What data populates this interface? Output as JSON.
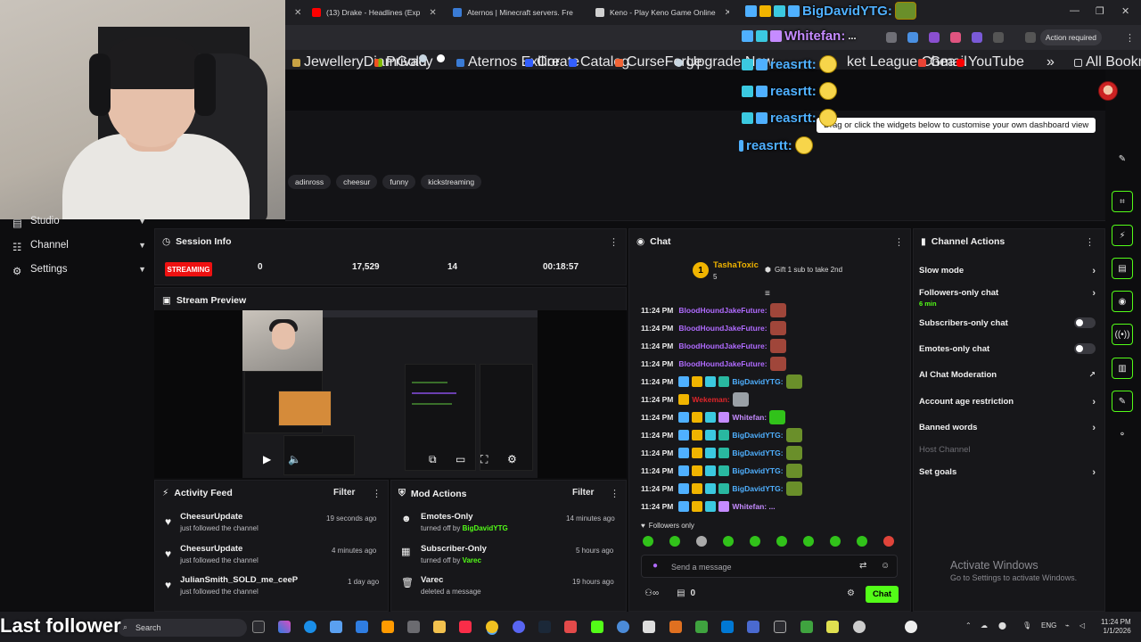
{
  "browser": {
    "tabs": [
      {
        "label": "(13) Drake - Headlines (Exp",
        "color": "#ff0000"
      },
      {
        "label": "Aternos | Minecraft servers. Fre",
        "color": "#3a7bd5"
      },
      {
        "label": "Keno - Play Keno Game Online",
        "color": "#d0d0d0"
      }
    ],
    "action_required": "Action required",
    "bookmarks": [
      "JewelleryDiamGold",
      "Privacy",
      "Aternos Exilior",
      "Create",
      "Catalog",
      "CurseForge",
      "Upgrade Now",
      "ket League Chea...",
      "Gmail",
      "YouTube",
      "All Bookmarks"
    ]
  },
  "overlay": {
    "chat": [
      {
        "name": "BigDavidYTG:",
        "color": "#4fb0ff"
      },
      {
        "name": "Whitefan:",
        "suffix": "...",
        "color": "#c58bff"
      },
      {
        "name": "reasrtt:",
        "color": "#4fb0ff"
      },
      {
        "name": "reasrtt:",
        "color": "#4fb0ff"
      },
      {
        "name": "reasrtt:",
        "color": "#4fb0ff"
      },
      {
        "name": "reasrtt:",
        "color": "#4fb0ff"
      }
    ],
    "last_follower": "Last follower"
  },
  "dashboard": {
    "tip": "Drag or click the widgets below to customise your own dashboard view",
    "tags": [
      "adinross",
      "cheesur",
      "funny",
      "kickstreaming"
    ]
  },
  "sidebar": {
    "items": [
      {
        "label": "Studio"
      },
      {
        "label": "Channel"
      },
      {
        "label": "Settings"
      }
    ]
  },
  "session": {
    "title": "Session Info",
    "status": "STREAMING",
    "stats": [
      "0",
      "17,529",
      "14",
      "00:18:57"
    ]
  },
  "preview": {
    "title": "Stream Preview"
  },
  "activity": {
    "title": "Activity Feed",
    "filter": "Filter",
    "items": [
      {
        "name": "CheesurUpdate",
        "sub": "just followed the channel",
        "time": "19 seconds ago"
      },
      {
        "name": "CheesurUpdate",
        "sub": "just followed the channel",
        "time": "4 minutes ago"
      },
      {
        "name": "JulianSmith_SOLD_me_ceeP",
        "sub": "just followed the channel",
        "time": "1 day ago"
      }
    ]
  },
  "mod": {
    "title": "Mod Actions",
    "filter": "Filter",
    "items": [
      {
        "name": "Emotes-Only",
        "sub": "turned off by",
        "by": "BigDavidYTG",
        "time": "14 minutes ago"
      },
      {
        "name": "Subscriber-Only",
        "sub": "turned off by",
        "by": "Varec",
        "time": "5 hours ago"
      },
      {
        "name": "Varec",
        "sub": "deleted a message",
        "by": "",
        "time": "19 hours ago"
      }
    ]
  },
  "chat": {
    "title": "Chat",
    "pinned_user": "TashaToxic",
    "pinned_count": "5",
    "pinned_text": "Gift 1 sub to take 2nd",
    "messages": [
      {
        "time": "11:24 PM",
        "user": "BloodHoundJakeFuture:",
        "color": "#b06bff"
      },
      {
        "time": "11:24 PM",
        "user": "BloodHoundJakeFuture:",
        "color": "#b06bff"
      },
      {
        "time": "11:24 PM",
        "user": "BloodHoundJakeFuture:",
        "color": "#b06bff"
      },
      {
        "time": "11:24 PM",
        "user": "BloodHoundJakeFuture:",
        "color": "#b06bff"
      },
      {
        "time": "11:24 PM",
        "user": "BigDavidYTG:",
        "color": "#4fb0ff"
      },
      {
        "time": "11:24 PM",
        "user": "Wekeman:",
        "color": "#e0252a"
      },
      {
        "time": "11:24 PM",
        "user": "Whitefan:",
        "color": "#c58bff"
      },
      {
        "time": "11:24 PM",
        "user": "BigDavidYTG:",
        "color": "#4fb0ff"
      },
      {
        "time": "11:24 PM",
        "user": "BigDavidYTG:",
        "color": "#4fb0ff"
      },
      {
        "time": "11:24 PM",
        "user": "BigDavidYTG:",
        "color": "#4fb0ff"
      },
      {
        "time": "11:24 PM",
        "user": "BigDavidYTG:",
        "color": "#4fb0ff"
      },
      {
        "time": "11:24 PM",
        "user": "Whitefan: ...",
        "color": "#c58bff"
      }
    ],
    "followers_only": "Followers only",
    "input_placeholder": "Send a message",
    "viewers": "0",
    "send": "Chat"
  },
  "channel_actions": {
    "title": "Channel Actions",
    "rows": [
      {
        "label": "Slow mode",
        "kind": "arrow"
      },
      {
        "label": "Followers-only chat",
        "sub": "6 min",
        "kind": "arrow"
      },
      {
        "label": "Subscribers-only chat",
        "kind": "toggle"
      },
      {
        "label": "Emotes-only chat",
        "kind": "toggle"
      },
      {
        "label": "AI Chat Moderation",
        "kind": "ext"
      },
      {
        "label": "Account age restriction",
        "kind": "arrow"
      },
      {
        "label": "Banned words",
        "kind": "arrow"
      },
      {
        "label": "Host Channel",
        "kind": "disabled"
      },
      {
        "label": "Set goals",
        "kind": "arrow"
      }
    ]
  },
  "windows": {
    "activate_title": "Activate Windows",
    "activate_sub": "Go to Settings to activate Windows.",
    "search": "Search",
    "lang": "ENG",
    "time": "11:24 PM",
    "date": "1/1/2026"
  },
  "colors": {
    "accent": "#53fc18",
    "live": "#ee1111",
    "panel": "#17171a"
  }
}
